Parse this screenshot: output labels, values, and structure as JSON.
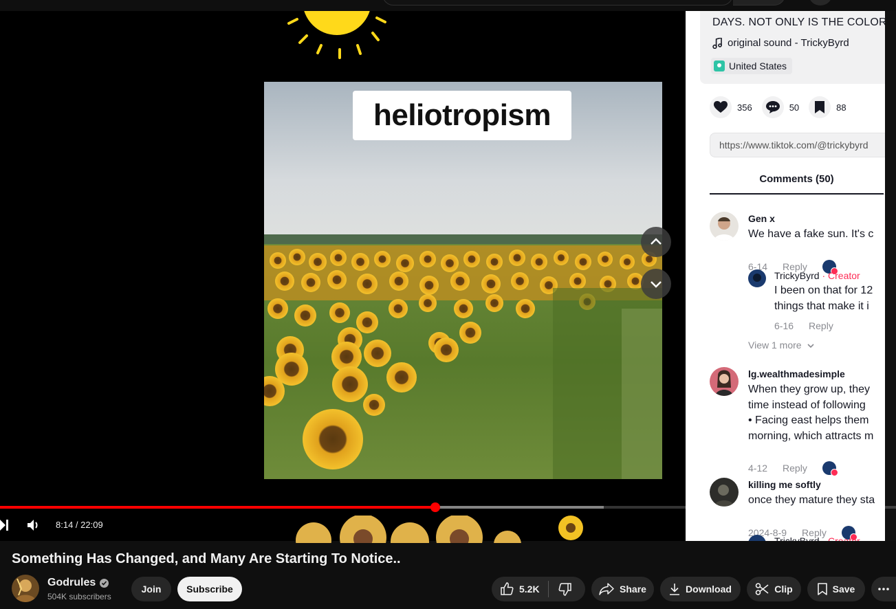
{
  "player": {
    "clip_caption": "heliotropism",
    "time_display": "8:14 / 22:09",
    "progress": {
      "played_fraction": 0.486,
      "loaded_fraction": 0.674
    }
  },
  "tiktok": {
    "description": "DAYS. NOT ONLY IS THE COLOR",
    "sound": "original sound - TrickyByrd",
    "location": "United States",
    "likes": "356",
    "comments_count": "50",
    "saves": "88",
    "link": "https://www.tiktok.com/@trickybyrd",
    "comments_tab": "Comments (50)",
    "comments": [
      {
        "name": "Gen x",
        "lines": [
          "We have a fake sun. It's c"
        ],
        "date": "6-14",
        "reply": "Reply"
      },
      {
        "name": "TrickyByrd",
        "tag": "· Creator",
        "lines": [
          "I been on that for 12",
          "things that make it i"
        ],
        "date": "6-16",
        "reply": "Reply"
      },
      {
        "name": "lg.wealthmadesimple",
        "lines": [
          "When they grow up, they",
          "time instead of following",
          "• Facing east helps them",
          "morning, which attracts m"
        ],
        "date": "4-12",
        "reply": "Reply"
      },
      {
        "name": "killing me softly",
        "lines": [
          "once they mature they sta"
        ],
        "date": "2024-8-9",
        "reply": "Reply"
      },
      {
        "name": "TrickyByrd",
        "tag": "· Creator"
      }
    ],
    "view_more": "View 1 more"
  },
  "video": {
    "title": "Something Has Changed, and Many Are Starting To Notice..",
    "channel": "Godrules",
    "subscribers": "504K subscribers",
    "join_label": "Join",
    "subscribe_label": "Subscribe",
    "likes": "5.2K",
    "share_label": "Share",
    "download_label": "Download",
    "clip_label": "Clip",
    "save_label": "Save"
  },
  "icons": [
    "next-icon",
    "volume-icon",
    "chevron-up-icon",
    "chevron-down-icon",
    "heart-icon",
    "comment-icon",
    "bookmark-icon",
    "music-note-icon",
    "location-icon",
    "verified-icon",
    "like-icon",
    "dislike-icon",
    "share-icon",
    "download-icon",
    "scissors-icon",
    "save-icon",
    "more-icon"
  ],
  "colors": {
    "progress": "#ff0000",
    "creator": "#fe2c55",
    "background": "#0f0f0f"
  }
}
